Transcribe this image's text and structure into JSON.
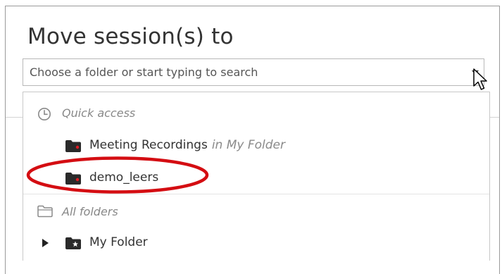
{
  "dialog": {
    "title": "Move session(s) to",
    "search": {
      "placeholder": "Choose a folder or start typing to search",
      "value": ""
    }
  },
  "dropdown": {
    "quick_access": {
      "label": "Quick access",
      "items": [
        {
          "name": "Meeting Recordings",
          "location": "in My Folder"
        },
        {
          "name": "demo_leers"
        }
      ]
    },
    "all_folders": {
      "label": "All folders",
      "items": [
        {
          "name": "My Folder"
        }
      ]
    }
  },
  "colors": {
    "highlight_ring": "#d40d12",
    "folder_icon": "#2a2a2a",
    "folder_dot": "#e11b22",
    "muted_text": "#888888"
  },
  "icons": {
    "quick_access": "clock-icon",
    "all_folders": "folder-outline-icon",
    "folder": "folder-icon",
    "my_folder": "folder-star-icon",
    "expand": "triangle-right-icon",
    "dropdown": "caret-down-icon",
    "pointer": "mouse-cursor-icon"
  }
}
